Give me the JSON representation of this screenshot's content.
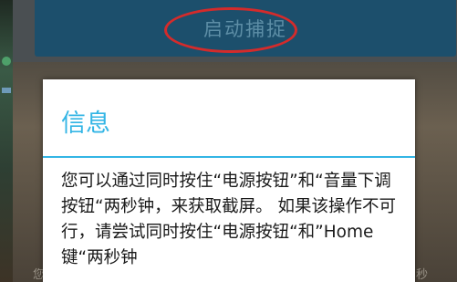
{
  "toolbar": {
    "start_capture_label": "启动捕捉"
  },
  "dialog": {
    "title": "信息",
    "message": "您可以通过同时按住“电源按钮”和“音量下调按钮“两秒钟，来获取截屏。 如果该操作不可行，请尝试同时按住“电源按钮“和”Home键“两秒钟"
  },
  "background": {
    "partial_text_left": "您",
    "partial_text_right": "秒"
  },
  "colors": {
    "accent": "#33b5e5",
    "button_bg": "#1c4f6c",
    "annotation": "#d42b2b"
  }
}
